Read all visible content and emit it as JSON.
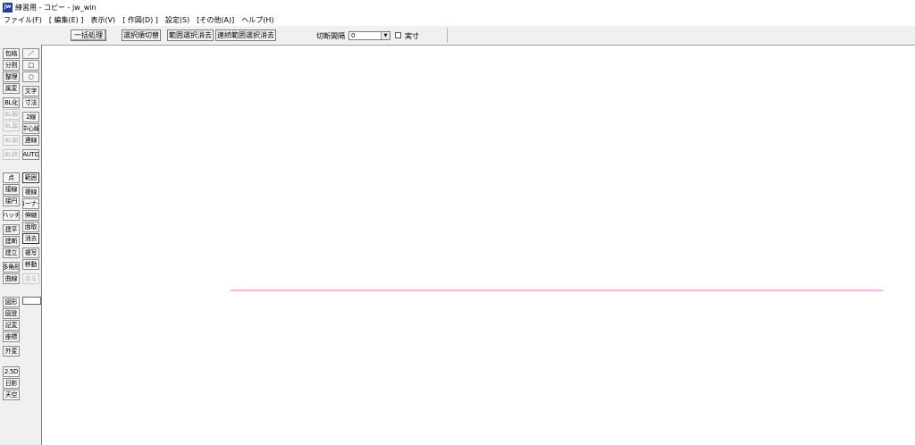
{
  "window": {
    "title": "練習用 - コピー - jw_win",
    "icon_label": "jw"
  },
  "menu": {
    "file": "ファイル(F)",
    "edit": "[ 編集(E) ]",
    "view": "表示(V)",
    "draw": "[ 作図(D) ]",
    "settings": "設定(S)",
    "other": "[その他(A)]",
    "help": "ヘルプ(H)"
  },
  "toolbar": {
    "batch": "一括処理",
    "select_order": "選択順切替",
    "range_erase": "範囲選択消去",
    "chain_erase": "連続範囲選択消去",
    "cut_interval_label": "切断間隔",
    "cut_interval_value": "0",
    "actual_size_label": "実寸"
  },
  "sidebar": {
    "left": [
      "包絡",
      "分割",
      "整理",
      "属変",
      "BL化",
      "BL解",
      "BL属",
      "BL編",
      "BL終",
      "点",
      "接線",
      "接円",
      "ハッチ",
      "建平",
      "建断",
      "建立",
      "多角形",
      "曲線",
      "図形",
      "図登",
      "記変",
      "座標",
      "外変",
      "2.5D",
      "日影",
      "天空"
    ],
    "right": [
      "／",
      "□",
      "○",
      "文字",
      "寸法",
      "2線",
      "中心線",
      "連線",
      "AUTO",
      "範囲",
      "複線",
      "コーナー",
      "伸縮",
      "面取",
      "消去",
      "複写",
      "移動",
      "戻る"
    ]
  },
  "canvas": {
    "line_color": "#ff66cc"
  },
  "colors": {
    "app_icon": "#1d3f9e",
    "toolbar_bg": "#f0f0f0",
    "draw_line": "#ff66cc"
  }
}
